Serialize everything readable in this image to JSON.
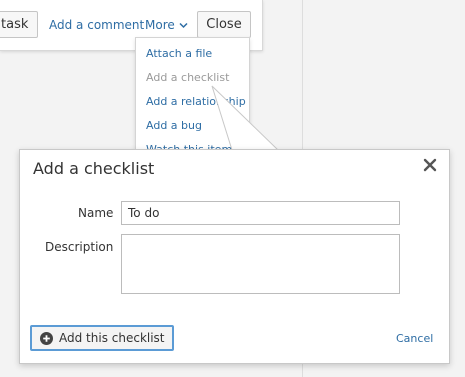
{
  "toolbar": {
    "task_label": "task",
    "add_comment_label": "Add a comment",
    "more_label": "More",
    "close_label": "Close"
  },
  "more_menu": {
    "items": [
      {
        "label": "Attach a file",
        "enabled": true
      },
      {
        "label": "Add a checklist",
        "enabled": false
      },
      {
        "label": "Add a relationship",
        "enabled": true
      },
      {
        "label": "Add a bug",
        "enabled": true
      },
      {
        "label": "Watch this item",
        "enabled": true
      }
    ]
  },
  "dialog": {
    "title": "Add a checklist",
    "name_label": "Name",
    "name_value": "To do",
    "description_label": "Description",
    "description_value": "",
    "submit_label": "Add this checklist",
    "cancel_label": "Cancel"
  },
  "colors": {
    "link": "#2e6da4",
    "focus_border": "#5b9bd5",
    "disabled_text": "#9a9a9a"
  }
}
